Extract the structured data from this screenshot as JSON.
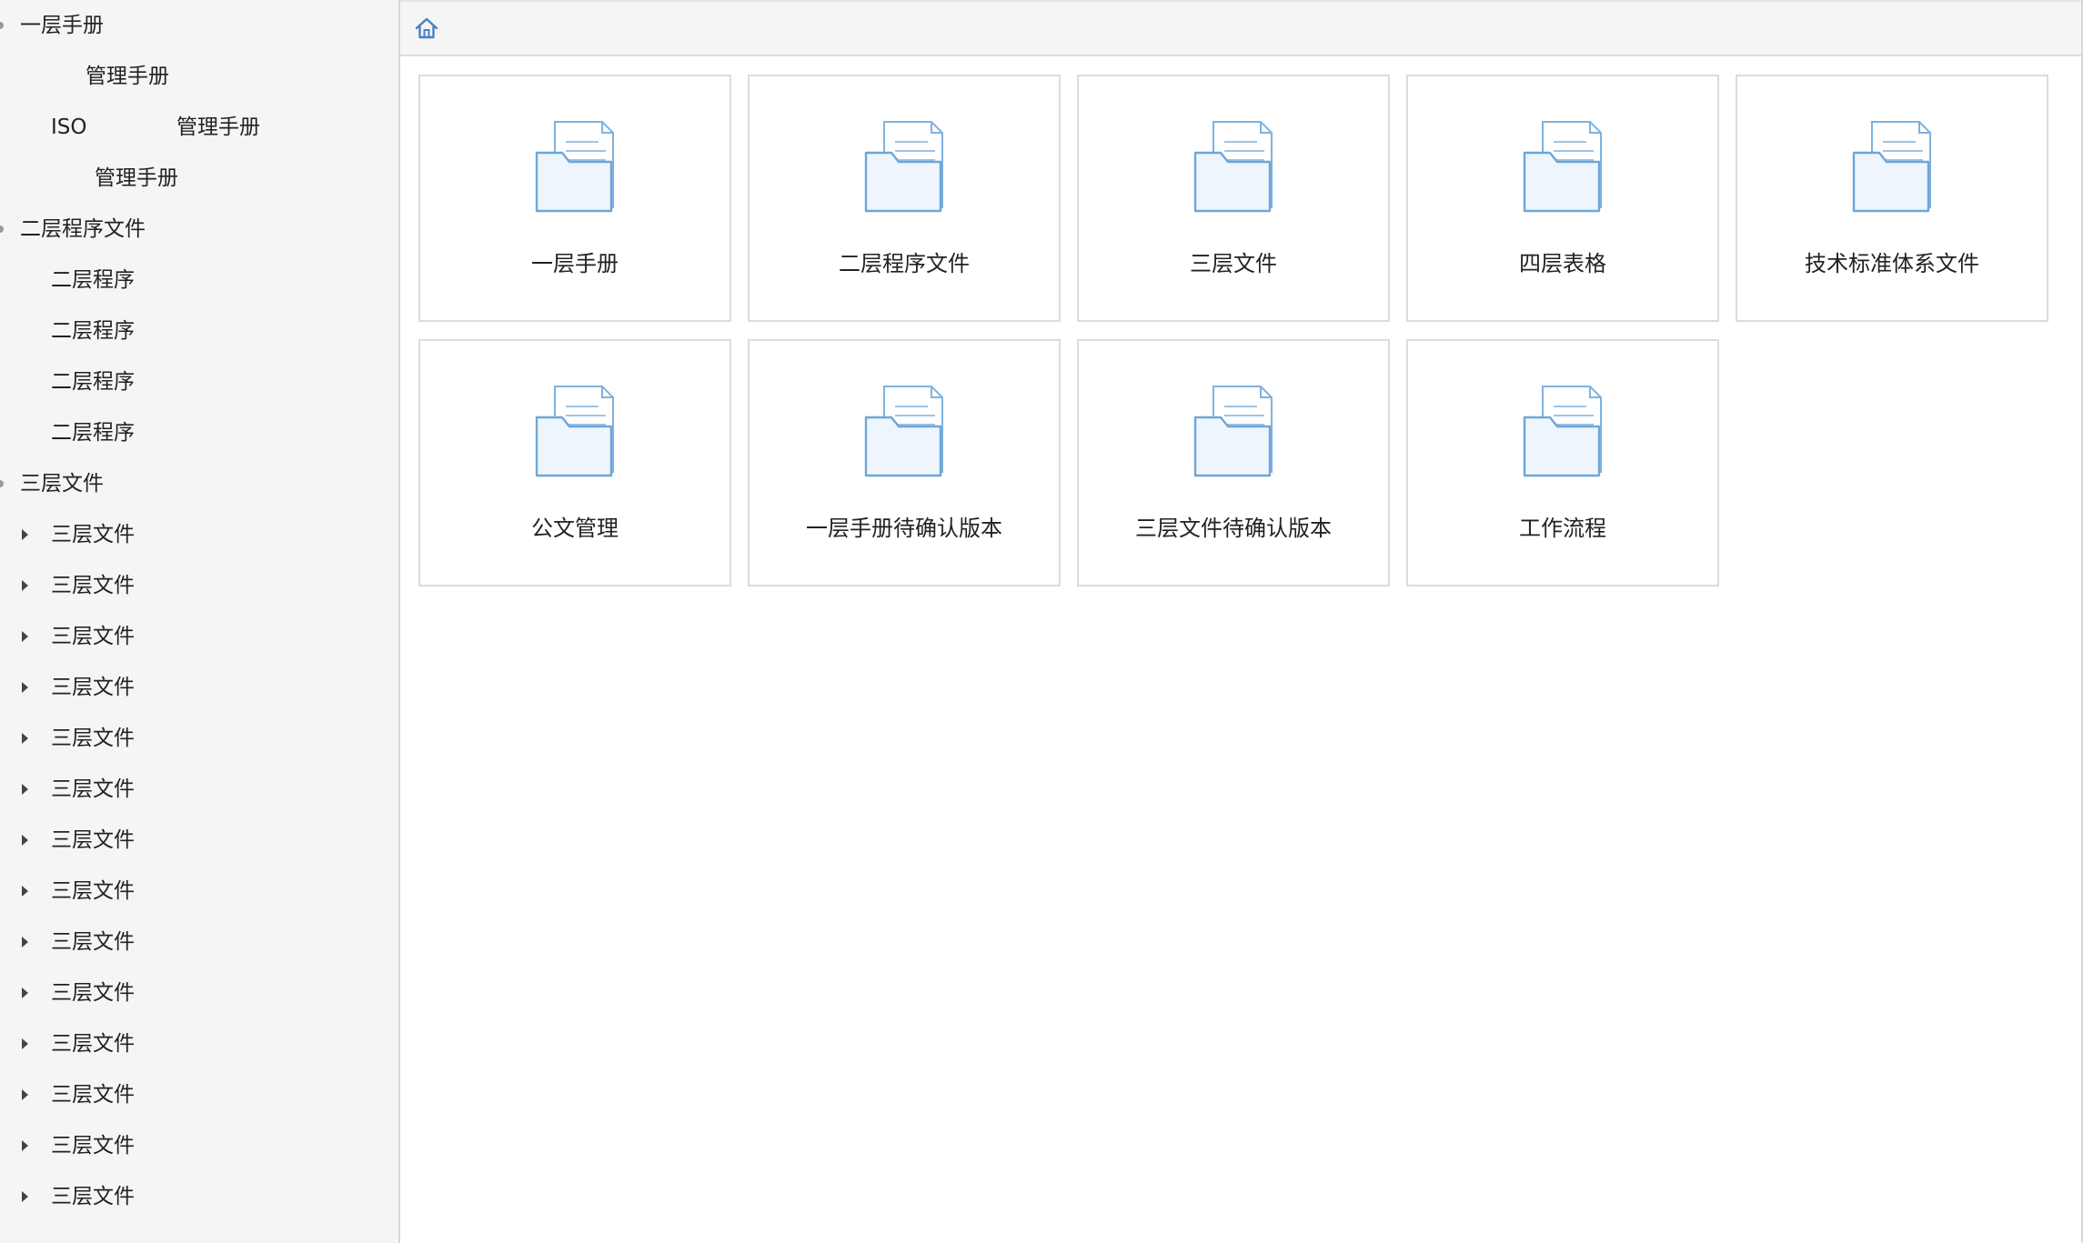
{
  "sidebar": {
    "items": [
      {
        "label": "一层手册",
        "level": 0,
        "dot": true
      },
      {
        "fragments": [
          "管理手册"
        ],
        "offsets": [
          0
        ],
        "level": "frag-a"
      },
      {
        "fragments": [
          "ISO",
          "管理手册"
        ],
        "level": "frag-b"
      },
      {
        "fragments": [
          "管理手册"
        ],
        "level": "frag-c"
      },
      {
        "label": "二层程序文件",
        "level": 0,
        "dot": true
      },
      {
        "label": "二层程序",
        "level": 1
      },
      {
        "label": "二层程序",
        "level": 1
      },
      {
        "label": "二层程序",
        "level": 1
      },
      {
        "label": "二层程序",
        "level": 1
      },
      {
        "label": "三层文件",
        "level": 0,
        "dot": true
      },
      {
        "label": "三层文件",
        "level": 1,
        "expander": true
      },
      {
        "label": "三层文件",
        "level": 1,
        "expander": true
      },
      {
        "label": "三层文件",
        "level": 1,
        "expander": true
      },
      {
        "label": "三层文件",
        "level": 1,
        "expander": true
      },
      {
        "label": "三层文件",
        "level": 1,
        "expander": true
      },
      {
        "label": "三层文件",
        "level": 1,
        "expander": true
      },
      {
        "label": "三层文件",
        "level": 1,
        "expander": true
      },
      {
        "label": "三层文件",
        "level": 1,
        "expander": true
      },
      {
        "label": "三层文件",
        "level": 1,
        "expander": true
      },
      {
        "label": "三层文件",
        "level": 1,
        "expander": true
      },
      {
        "label": "三层文件",
        "level": 1,
        "expander": true
      },
      {
        "label": "三层文件",
        "level": 1,
        "expander": true
      },
      {
        "label": "三层文件",
        "level": 1,
        "expander": true
      },
      {
        "label": "三层文件",
        "level": 1,
        "expander": true
      }
    ]
  },
  "topbar": {
    "home_icon": "home-icon"
  },
  "tiles": [
    {
      "label": "一层手册",
      "icon": "folder-document-icon"
    },
    {
      "label": "二层程序文件",
      "icon": "folder-document-icon"
    },
    {
      "label": "三层文件",
      "icon": "folder-document-icon"
    },
    {
      "label": "四层表格",
      "icon": "folder-document-icon"
    },
    {
      "label": "技术标准体系文件",
      "icon": "folder-document-icon"
    },
    {
      "label": "公文管理",
      "icon": "folder-document-icon"
    },
    {
      "label": "一层手册待确认版本",
      "icon": "folder-document-icon"
    },
    {
      "label": "三层文件待确认版本",
      "icon": "folder-document-icon"
    },
    {
      "label": "工作流程",
      "icon": "folder-document-icon"
    }
  ],
  "colors": {
    "icon_blue": "#6ea6d8",
    "icon_fill": "#eef5fc",
    "home_blue": "#4a7fc1"
  }
}
